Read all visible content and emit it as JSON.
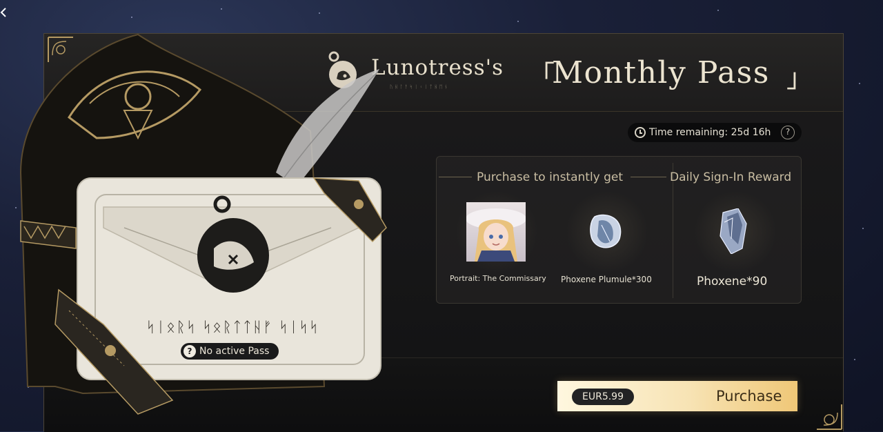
{
  "header": {
    "name": "Lunotress's",
    "bracket_open": "「",
    "pass_title": "Monthly Pass",
    "bracket_close": "」",
    "subtitle": "ᚢᚺᛚᚨᛋᛁᚲᛁᛏᚺᛖᚾ"
  },
  "timer": {
    "label": "Time remaining: 25d 16h",
    "help": "?"
  },
  "card": {
    "runic_title": "ᛋᛁᛟᚱᛋ ᛋᛟᚱᛏᛏᚺᚠ ᛋᛁᛋᛋ",
    "status_help": "?",
    "status": "No active Pass"
  },
  "rewards": {
    "instant_label": "Purchase to instantly get",
    "daily_label": "Daily Sign-In Reward",
    "instant_items": [
      {
        "name": "Portrait: The Commissary",
        "icon": "portrait-icon"
      },
      {
        "name": "Phoxene Plumule*300",
        "icon": "plumule-gem-icon"
      }
    ],
    "daily_item": {
      "name": "Phoxene*90",
      "icon": "phoxene-crystal-icon"
    }
  },
  "purchase": {
    "price": "EUR5.99",
    "label": "Purchase"
  },
  "colors": {
    "accent_gold": "#b59a63",
    "button_gradient_start": "#fff7df",
    "button_gradient_end": "#efc777"
  }
}
